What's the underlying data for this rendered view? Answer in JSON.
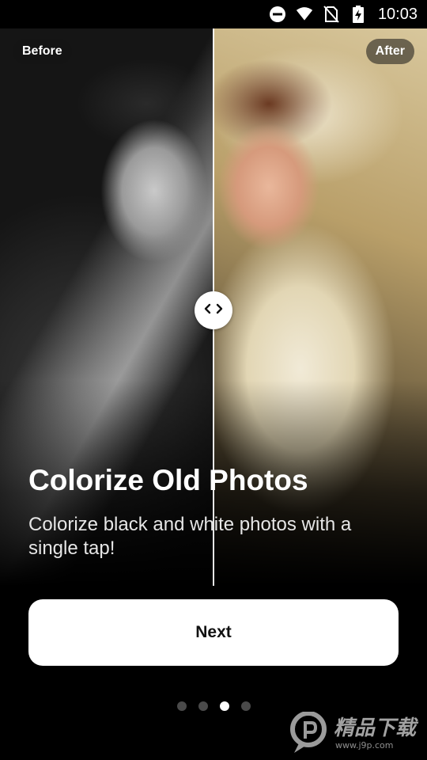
{
  "status_bar": {
    "time": "10:03",
    "icons": [
      "do-not-disturb-icon",
      "wifi-icon",
      "no-sim-icon",
      "battery-charging-icon"
    ]
  },
  "compare": {
    "before_label": "Before",
    "after_label": "After",
    "handle_icon": "left-right-arrows-icon"
  },
  "onboarding": {
    "title": "Colorize Old Photos",
    "subtitle": "Colorize black and white photos with a single tap!",
    "next_label": "Next",
    "page_count": 4,
    "active_page": 3
  },
  "watermark": {
    "logo_icon": "jingpin-logo-icon",
    "title": "精品下载",
    "subtitle": "www.j9p.com"
  }
}
